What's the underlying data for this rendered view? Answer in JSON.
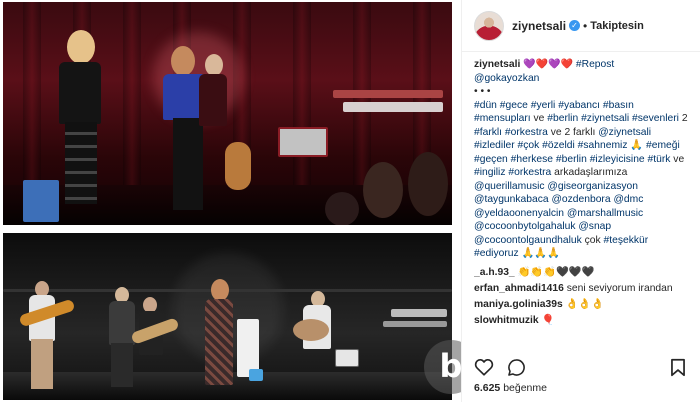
{
  "post": {
    "images": [
      {
        "name": "concert-stage-photo-top",
        "description_icon": "photo"
      },
      {
        "name": "concert-band-photo-bottom",
        "description_icon": "photo"
      }
    ]
  },
  "header": {
    "username": "ziynetsali",
    "verified_icon": "verified-badge-icon",
    "separator": "•",
    "follow_label": "Takiptesin"
  },
  "caption": {
    "username": "ziynetsali",
    "hearts": [
      "💜",
      "❤️",
      "💜",
      "❤️"
    ],
    "line1_tag": "#Repost",
    "mention_author": "@gokayozkan",
    "dots": "• • •",
    "body_parts": [
      {
        "t": "#dün",
        "tag": true
      },
      {
        "t": " ",
        "tag": false
      },
      {
        "t": "#gece",
        "tag": true
      },
      {
        "t": " ",
        "tag": false
      },
      {
        "t": "#yerli",
        "tag": true
      },
      {
        "t": " ",
        "tag": false
      },
      {
        "t": "#yabancı",
        "tag": true
      },
      {
        "t": " ",
        "tag": false
      },
      {
        "t": "#basın",
        "tag": true
      },
      {
        "t": " ",
        "tag": false
      },
      {
        "t": "#mensupları",
        "tag": true
      },
      {
        "t": " ve ",
        "tag": false
      },
      {
        "t": "#berlin",
        "tag": true
      },
      {
        "t": " ",
        "tag": false
      },
      {
        "t": "#ziynetsali",
        "tag": true
      },
      {
        "t": " ",
        "tag": false
      },
      {
        "t": "#sevenleri",
        "tag": true
      },
      {
        "t": " 2 ",
        "tag": false
      },
      {
        "t": "#farklı",
        "tag": true
      },
      {
        "t": " ",
        "tag": false
      },
      {
        "t": "#orkestra",
        "tag": true
      },
      {
        "t": " ve 2 farklı ",
        "tag": false
      },
      {
        "t": "@ziynetsali",
        "tag": true
      },
      {
        "t": " ",
        "tag": false
      },
      {
        "t": "#izlediler",
        "tag": true
      },
      {
        "t": " ",
        "tag": false
      },
      {
        "t": "#çok",
        "tag": true
      },
      {
        "t": " ",
        "tag": false
      },
      {
        "t": "#özeldi",
        "tag": true
      },
      {
        "t": " ",
        "tag": false
      },
      {
        "t": "#sahnemiz",
        "tag": true
      },
      {
        "t": " 🙏 ",
        "tag": false
      },
      {
        "t": "#emeği",
        "tag": true
      },
      {
        "t": " ",
        "tag": false
      },
      {
        "t": "#geçen",
        "tag": true
      },
      {
        "t": " ",
        "tag": false
      },
      {
        "t": "#herkese",
        "tag": true
      },
      {
        "t": " ",
        "tag": false
      },
      {
        "t": "#berlin",
        "tag": true
      },
      {
        "t": " ",
        "tag": false
      },
      {
        "t": "#izleyicisine",
        "tag": true
      },
      {
        "t": " ",
        "tag": false
      },
      {
        "t": "#türk",
        "tag": true
      },
      {
        "t": " ve ",
        "tag": false
      },
      {
        "t": "#ingiliz",
        "tag": true
      },
      {
        "t": " ",
        "tag": false
      },
      {
        "t": "#orkestra",
        "tag": true
      },
      {
        "t": " arkadaşlarımıza ",
        "tag": false
      },
      {
        "t": "@querillamusic",
        "tag": true
      },
      {
        "t": " ",
        "tag": false
      },
      {
        "t": "@giseorganizasyon",
        "tag": true
      },
      {
        "t": " ",
        "tag": false
      },
      {
        "t": "@taygunkabaca",
        "tag": true
      },
      {
        "t": " ",
        "tag": false
      },
      {
        "t": "@ozdenbora",
        "tag": true
      },
      {
        "t": " ",
        "tag": false
      },
      {
        "t": "@dmc",
        "tag": true
      },
      {
        "t": " ",
        "tag": false
      },
      {
        "t": "@yeldaoonenyalcin",
        "tag": true
      },
      {
        "t": " ",
        "tag": false
      },
      {
        "t": "@marshallmusic",
        "tag": true
      },
      {
        "t": " ",
        "tag": false
      },
      {
        "t": "@cocoonbytolgahaluk",
        "tag": true
      },
      {
        "t": " ",
        "tag": false
      },
      {
        "t": "@snap",
        "tag": true
      },
      {
        "t": " ",
        "tag": false
      },
      {
        "t": "@cocoontolgaundhaluk",
        "tag": true
      },
      {
        "t": " çok ",
        "tag": false
      },
      {
        "t": "#teşekkür",
        "tag": true
      },
      {
        "t": " ",
        "tag": false
      },
      {
        "t": "#ediyoruz",
        "tag": true
      },
      {
        "t": " 🙏🙏🙏",
        "tag": false
      }
    ]
  },
  "comments": [
    {
      "user": "_a.h.93_",
      "text": "👏👏👏🖤🖤🖤"
    },
    {
      "user": "erfan_ahmadi1416",
      "text": "seni seviyorum irandan"
    },
    {
      "user": "maniya.golinia39s",
      "text": "👌👌👌"
    },
    {
      "user": "slowhitmuzik",
      "text": "🎈"
    }
  ],
  "actions": {
    "like_icon": "heart-outline-icon",
    "comment_icon": "comment-bubble-icon",
    "save_icon": "bookmark-icon"
  },
  "likes": {
    "count": "6.625",
    "label": "beğenme"
  },
  "watermark": {
    "letter": "b",
    "color": "#5a5a5a"
  },
  "colors": {
    "link": "#003569",
    "verified": "#3897f0",
    "text": "#262626",
    "border": "#efefef"
  }
}
